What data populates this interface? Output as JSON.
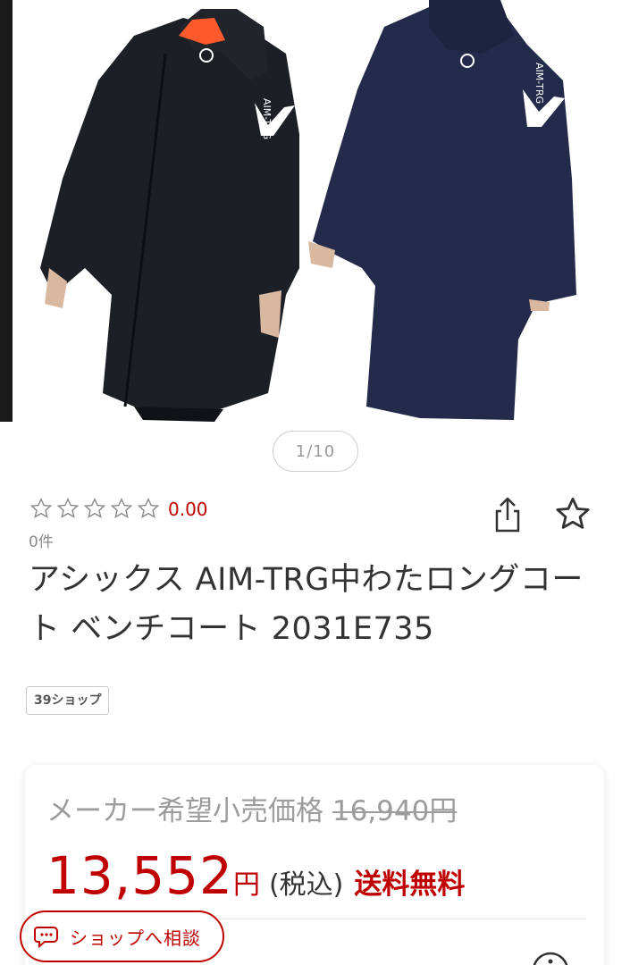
{
  "gallery": {
    "counter": "1/10",
    "colors": {
      "black_coat": "#1d1f27",
      "navy_coat": "#242a4a",
      "accent_orange": "#ff5a2c"
    }
  },
  "product": {
    "rating_value": "0.00",
    "review_count": "0件",
    "title": "アシックス AIM-TRG中わたロングコート ベンチコート 2031E735",
    "shop_tag": "39ショップ"
  },
  "price": {
    "list_price_label": "メーカー希望小売価格 ",
    "list_price_value": "16,940円",
    "sale_price": "13,552",
    "yen_sign": "円",
    "tax_label": "(税込)",
    "shipping_label": "送料無料"
  },
  "actions": {
    "share_icon": "share-icon",
    "favorite_icon": "star-outline-icon",
    "consult_label": "ショップへ相談"
  },
  "colors": {
    "accent_red": "#bf0000",
    "text_main": "#333333",
    "text_muted": "#9c9c9c"
  }
}
